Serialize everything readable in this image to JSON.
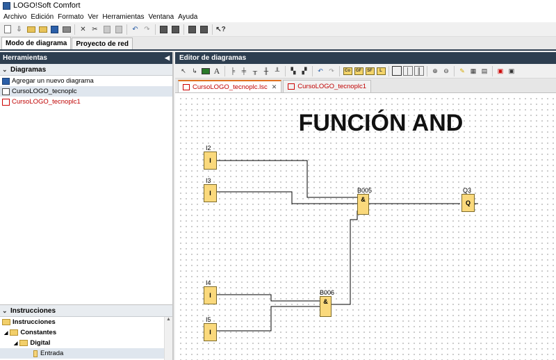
{
  "window": {
    "title": "LOGO!Soft Comfort"
  },
  "menu": [
    "Archivo",
    "Edición",
    "Formato",
    "Ver",
    "Herramientas",
    "Ventana",
    "Ayuda"
  ],
  "mode_tabs": [
    {
      "label": "Modo de diagrama",
      "active": true
    },
    {
      "label": "Proyecto de red",
      "active": false
    }
  ],
  "tools_panel": {
    "title": "Herramientas",
    "diagrams_header": "Diagramas",
    "items": [
      {
        "label": "Agregar un nuevo diagrama",
        "icon": "add-diagram-icon"
      },
      {
        "label": "CursoLOGO_tecnoplc",
        "icon": "diagram-icon",
        "selected": true
      },
      {
        "label": "CursoLOGO_tecnoplc1",
        "icon": "diagram-sim-icon",
        "red": true
      }
    ],
    "instructions_header": "Instrucciones",
    "instructions_tree": [
      "Instrucciones",
      "Constantes",
      "Digital",
      "Entrada"
    ]
  },
  "editor": {
    "title": "Editor de diagramas",
    "tabs": [
      {
        "label": "CursoLOGO_tecnoplc.lsc",
        "active": true
      },
      {
        "label": "CursoLOGO_tecnoplc1",
        "active": false
      }
    ],
    "diagram_title": "FUNCIÓN AND",
    "toolbar_boxes": [
      "Co",
      "GF",
      "SF",
      "L"
    ],
    "blocks": {
      "i2": {
        "label": "I2",
        "text": "I"
      },
      "i3": {
        "label": "I3",
        "text": "I"
      },
      "i4": {
        "label": "I4",
        "text": "I"
      },
      "i5": {
        "label": "I5",
        "text": "I"
      },
      "b005": {
        "label": "B005",
        "text": "&"
      },
      "b006": {
        "label": "B006",
        "text": "&"
      },
      "q3": {
        "label": "Q3",
        "text": "Q"
      }
    }
  },
  "colors": {
    "panel_header": "#2d3e50",
    "block_fill": "#fad97c",
    "red_text": "#c00000"
  }
}
